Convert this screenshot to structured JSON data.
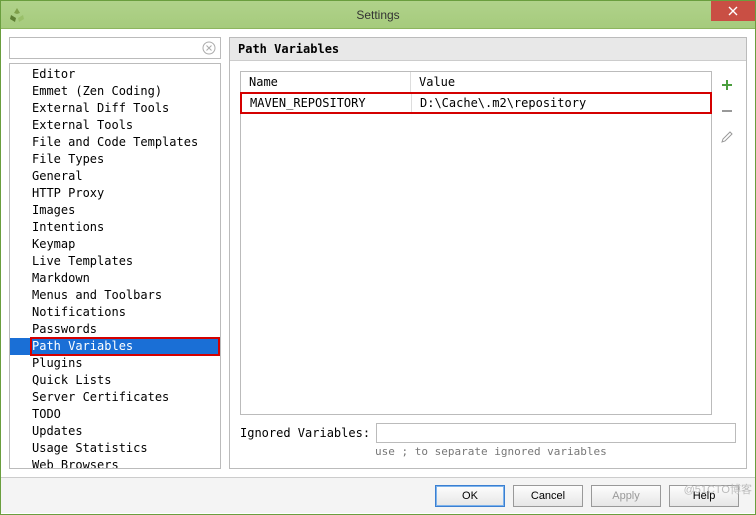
{
  "window": {
    "title": "Settings"
  },
  "search": {
    "value": ""
  },
  "tree": {
    "items": [
      "Editor",
      "Emmet (Zen Coding)",
      "External Diff Tools",
      "External Tools",
      "File and Code Templates",
      "File Types",
      "General",
      "HTTP Proxy",
      "Images",
      "Intentions",
      "Keymap",
      "Live Templates",
      "Markdown",
      "Menus and Toolbars",
      "Notifications",
      "Passwords",
      "Path Variables",
      "Plugins",
      "Quick Lists",
      "Server Certificates",
      "TODO",
      "Updates",
      "Usage Statistics",
      "Web Browsers"
    ],
    "selected_index": 16
  },
  "panel": {
    "title": "Path Variables",
    "columns": {
      "name": "Name",
      "value": "Value"
    },
    "rows": [
      {
        "name": "MAVEN_REPOSITORY",
        "value": "D:\\Cache\\.m2\\repository"
      }
    ],
    "ignored_label": "Ignored Variables:",
    "ignored_value": "",
    "hint": "use ; to separate ignored variables"
  },
  "buttons": {
    "ok": "OK",
    "cancel": "Cancel",
    "apply": "Apply",
    "help": "Help"
  },
  "watermark": "@51CTO博客"
}
